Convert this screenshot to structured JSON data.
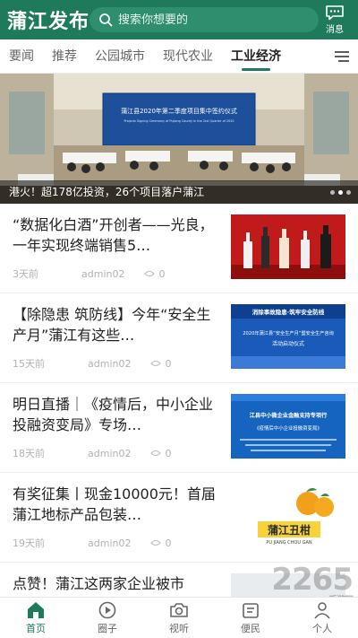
{
  "header": {
    "logo": "蒲江发布",
    "search_placeholder": "搜索你想要的",
    "message_label": "消息"
  },
  "tabs": [
    {
      "label": "要闻"
    },
    {
      "label": "推荐"
    },
    {
      "label": "公园城市"
    },
    {
      "label": "现代农业"
    },
    {
      "label": "工业经济",
      "active": true
    }
  ],
  "banner": {
    "caption": "港火！超178亿投资，26个项目落户蒲江",
    "screen_title": "蒲江县2020年第二季度项目集中签约仪式",
    "screen_subtitle": "Projects Signing Ceremony of Pujiang County in the 2nd Quarter of 2020",
    "slide_index": 2,
    "slide_count": 3
  },
  "news": [
    {
      "title": "“数据化白酒”开创者——光良，一年实现终端销售5…",
      "time": "3天前",
      "author": "admin02",
      "views": "0"
    },
    {
      "title": "【除隐患 筑防线】今年“安全生产月”蒲江有这些…",
      "time": "15天前",
      "author": "admin02",
      "views": "0",
      "thumb_text": [
        "消除事故隐患·筑牢安全防线",
        "2020年蒲江县“安全生产月”暨安全生产咨询",
        "活动启动仪式"
      ]
    },
    {
      "title": "明日直播｜《疫情后，中小企业投融资变局》专场…",
      "time": "18天前",
      "author": "admin02",
      "views": "0",
      "thumb_text": [
        "江县中小微企业金融支持专项行",
        "《疫情后中小企业投融资变局》"
      ]
    },
    {
      "title": "有奖征集丨现金10000元！首届蒲江地标产品包装…",
      "time": "19天前",
      "author": "admin02",
      "views": "0",
      "thumb_text": [
        "蒲江丑柑",
        "PU JIANG CHOU GAN"
      ]
    },
    {
      "title": "点赞！蒲江这两家企业被市",
      "time": "",
      "author": "",
      "views": ""
    }
  ],
  "bottom_nav": [
    {
      "label": "首页",
      "icon": "home-icon",
      "active": true
    },
    {
      "label": "圈子",
      "icon": "play-circle-icon"
    },
    {
      "label": "视听",
      "icon": "camera-icon"
    },
    {
      "label": "便民",
      "icon": "service-icon"
    },
    {
      "label": "个人",
      "icon": "person-icon"
    }
  ],
  "watermark": {
    "text": "2265",
    "sub": "手游网"
  },
  "colors": {
    "brand": "#1f7a5c",
    "tab_underline": "#1f7a5c"
  }
}
